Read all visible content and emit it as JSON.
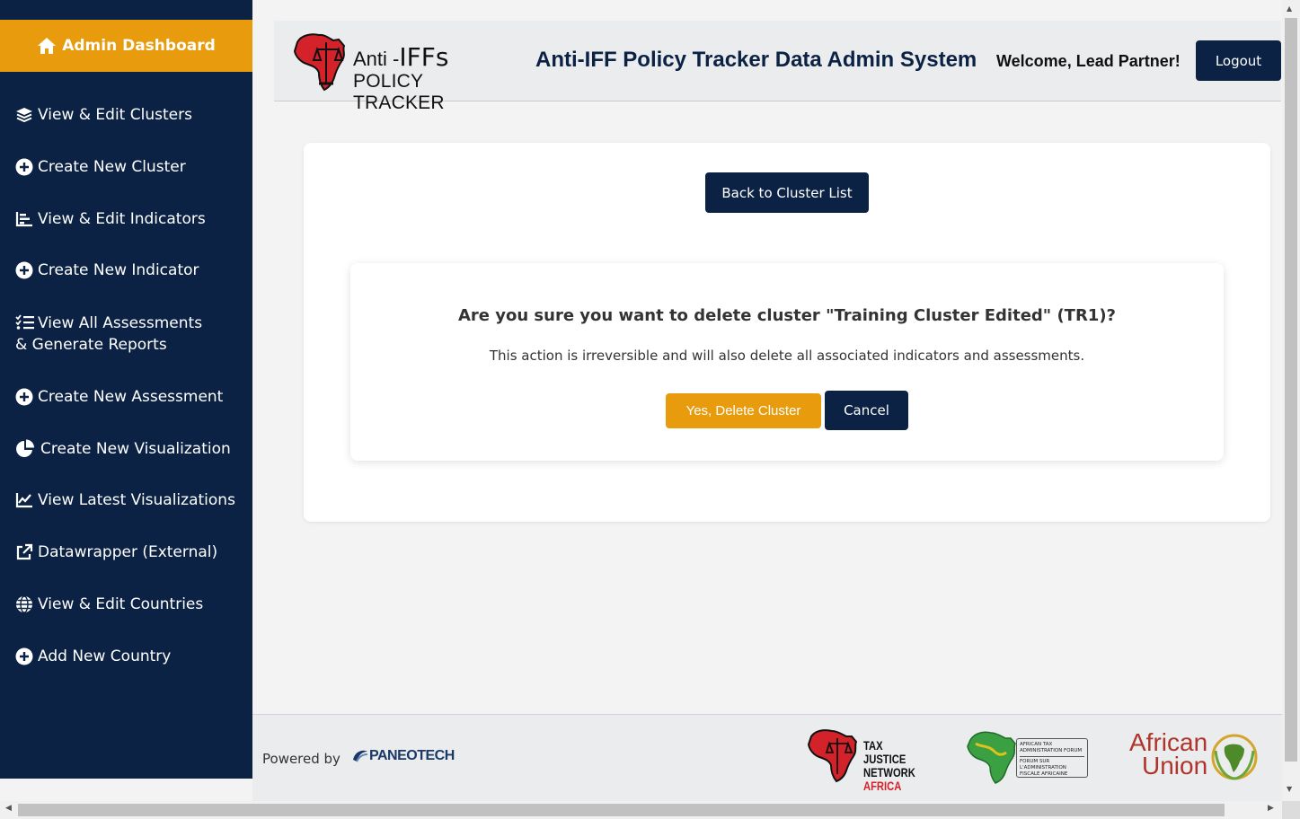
{
  "sidebar": {
    "dashboard_label": "Admin Dashboard",
    "items": [
      {
        "label": "View & Edit Clusters",
        "icon": "layers-icon"
      },
      {
        "label": "Create New Cluster",
        "icon": "plus-circle-icon"
      },
      {
        "label": "View & Edit Indicators",
        "icon": "bar-chart-icon"
      },
      {
        "label": "Create New Indicator",
        "icon": "plus-circle-icon"
      },
      {
        "label": "View All Assessments & Generate Reports",
        "icon": "list-check-icon"
      },
      {
        "label": "Create New Assessment",
        "icon": "plus-circle-icon"
      },
      {
        "label": "Create New Visualization",
        "icon": "pie-chart-icon"
      },
      {
        "label": "View Latest Visualizations",
        "icon": "line-chart-icon"
      },
      {
        "label": "Datawrapper (External)",
        "icon": "external-link-icon"
      },
      {
        "label": "View & Edit Countries",
        "icon": "globe-icon"
      },
      {
        "label": "Add New Country",
        "icon": "plus-circle-icon"
      }
    ]
  },
  "header": {
    "logo_line1_a": "Anti -",
    "logo_line1_b": "IFFs",
    "logo_line2": "POLICY TRACKER",
    "title": "Anti-IFF Policy Tracker Data Admin System",
    "welcome": "Welcome, Lead Partner!",
    "logout_label": "Logout"
  },
  "main": {
    "back_label": "Back to Cluster List",
    "confirm_question": "Are you sure you want to delete cluster \"Training Cluster Edited\" (TR1)?",
    "confirm_message": "This action is irreversible and will also delete all associated indicators and assessments.",
    "yes_label": "Yes, Delete Cluster",
    "cancel_label": "Cancel"
  },
  "footer": {
    "powered_by": "Powered by",
    "paneo": "PANEOTECH",
    "tjn_line1": "TAX JUSTICE",
    "tjn_line2": "NETWORK",
    "tjn_line3": "AFRICA",
    "ataf_line1": "AFRICAN TAX ADMINISTRATION FORUM",
    "ataf_line2": "FORUM SUR L'ADMINISTRATION FISCALE AFRICAINE",
    "au_line1": "African",
    "au_line2": "Union"
  },
  "colors": {
    "navy": "#0b2244",
    "amber": "#e89b0c",
    "au_red": "#b0342a"
  }
}
